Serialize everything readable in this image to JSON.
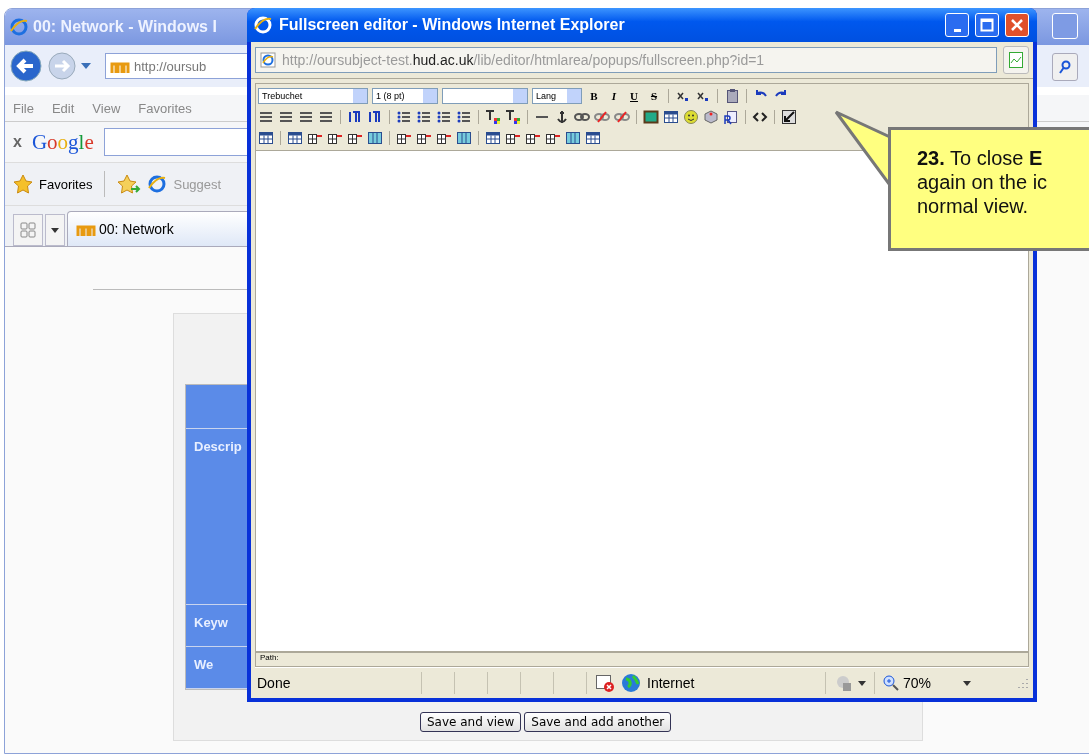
{
  "background_window": {
    "title": "00: Network - Windows I",
    "address": "http://oursub",
    "menu": [
      "File",
      "Edit",
      "View",
      "Favorites"
    ],
    "google": {
      "close": "x",
      "logo": "Google"
    },
    "favorites_bar": {
      "favorites": "Favorites",
      "suggested": "Suggest"
    },
    "tab": {
      "label": "00: Network"
    },
    "form": {
      "row_labels": [
        "Descrip",
        "Keyw",
        "We"
      ],
      "buttons": [
        "Save and view",
        "Save and add another"
      ]
    }
  },
  "popup": {
    "title": "Fullscreen editor - Windows Internet Explorer",
    "address": {
      "prefix": "http://oursubject-test.",
      "domain": "hud.ac.uk",
      "suffix": "/lib/editor/htmlarea/popups/fullscreen.php?id=1"
    },
    "toolbar": {
      "font": "Trebuchet",
      "size": "1 (8 pt)",
      "lang": "Lang",
      "format_buttons": [
        "B",
        "I",
        "U",
        "S"
      ]
    },
    "path_label": "Path:",
    "status": {
      "text": "Done",
      "zone": "Internet",
      "zoom": "70%"
    }
  },
  "callout": {
    "lines": [
      "**23.** To close **E**",
      "again on the ic",
      "normal view."
    ]
  }
}
